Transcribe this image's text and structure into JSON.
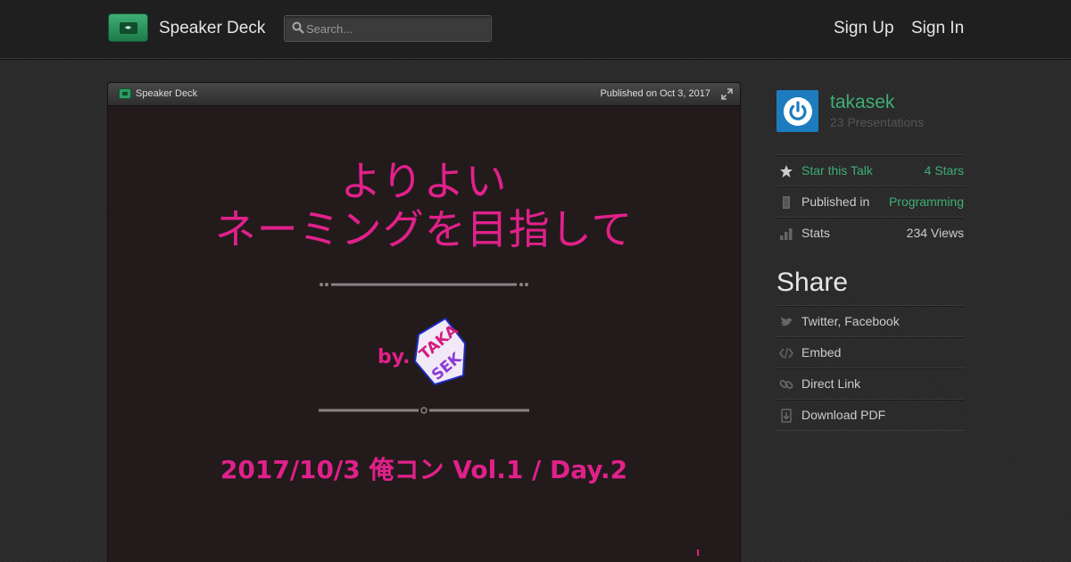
{
  "header": {
    "brand": "Speaker Deck",
    "search_placeholder": "Search...",
    "sign_up": "Sign Up",
    "sign_in": "Sign In"
  },
  "player": {
    "brand": "Speaker Deck",
    "published": "Published on Oct 3, 2017",
    "slide": {
      "title_line1": "よりよい",
      "title_line2": "ネーミングを目指して",
      "byline": "by.",
      "author_logo_text": "TAKASEK",
      "event": "2017/10/3 俺コン Vol.1 / Day.2"
    }
  },
  "sidebar": {
    "user": {
      "name": "takasek",
      "presentations": "23 Presentations"
    },
    "meta": [
      {
        "label": "Star this Talk",
        "value": "4 Stars",
        "icon": "star-icon"
      },
      {
        "label": "Published in",
        "value": "Programming",
        "icon": "bookmark-icon"
      },
      {
        "label": "Stats",
        "value": "234 Views",
        "icon": "stats-icon"
      }
    ],
    "share_title": "Share",
    "share": [
      {
        "label": "Twitter, Facebook",
        "icon": "bird-icon"
      },
      {
        "label": "Embed",
        "icon": "code-icon"
      },
      {
        "label": "Direct Link",
        "icon": "link-icon"
      },
      {
        "label": "Download PDF",
        "icon": "download-icon"
      }
    ]
  },
  "colors": {
    "accent_green": "#3fae74",
    "slide_pink": "#e0218a",
    "slide_bg": "#231a1b",
    "avatar_blue": "#1d7cbd"
  }
}
